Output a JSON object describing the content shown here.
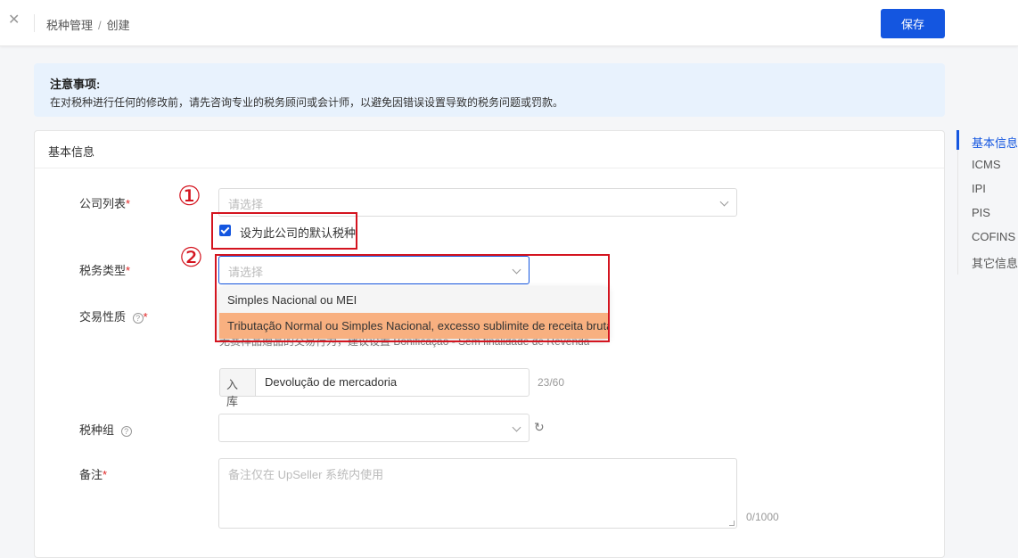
{
  "header": {
    "breadcrumb_parent": "税种管理",
    "breadcrumb_sep": "/",
    "breadcrumb_current": "创建",
    "save_label": "保存"
  },
  "notice": {
    "title": "注意事项:",
    "text": "在对税种进行任何的修改前，请先咨询专业的税务顾问或会计师，以避免因错误设置导致的税务问题或罚款。"
  },
  "section": {
    "title": "基本信息"
  },
  "form": {
    "company_label": "公司列表",
    "company_placeholder": "请选择",
    "default_checkbox_label": "设为此公司的默认税种",
    "default_checked": true,
    "tax_type_label": "税务类型",
    "tax_type_placeholder": "请选择",
    "tax_type_options": [
      "Simples Nacional ou MEI",
      "Tributação Normal ou Simples Nacional, excesso sublimite de receita bruta"
    ],
    "transaction_label": "交易性质",
    "transaction_hint": "无赛样品赠品的交易行为，建议设置 Bonificação - Sem finalidade de Revenda",
    "transaction_prefix": "入库",
    "transaction_value": "Devolução de mercadoria",
    "transaction_counter": "23/60",
    "tax_group_label": "税种组",
    "remark_label": "备注",
    "remark_placeholder": "备注仅在 UpSeller 系统内使用",
    "remark_counter": "0/1000",
    "required_mark": "*",
    "help_mark": "?"
  },
  "annotations": {
    "marker_1": "①",
    "marker_2": "②"
  },
  "anchor_nav": [
    "基本信息",
    "ICMS",
    "IPI",
    "PIS",
    "COFINS",
    "其它信息"
  ],
  "colors": {
    "primary": "#1456e0",
    "annotation_red": "#d4141f",
    "highlight_orange": "#f8b080",
    "notice_bg": "#e8f2fd"
  },
  "icons": {
    "close": "close-icon",
    "chevron": "chevron-down-icon",
    "help": "question-circle-icon",
    "refresh": "refresh-icon"
  }
}
